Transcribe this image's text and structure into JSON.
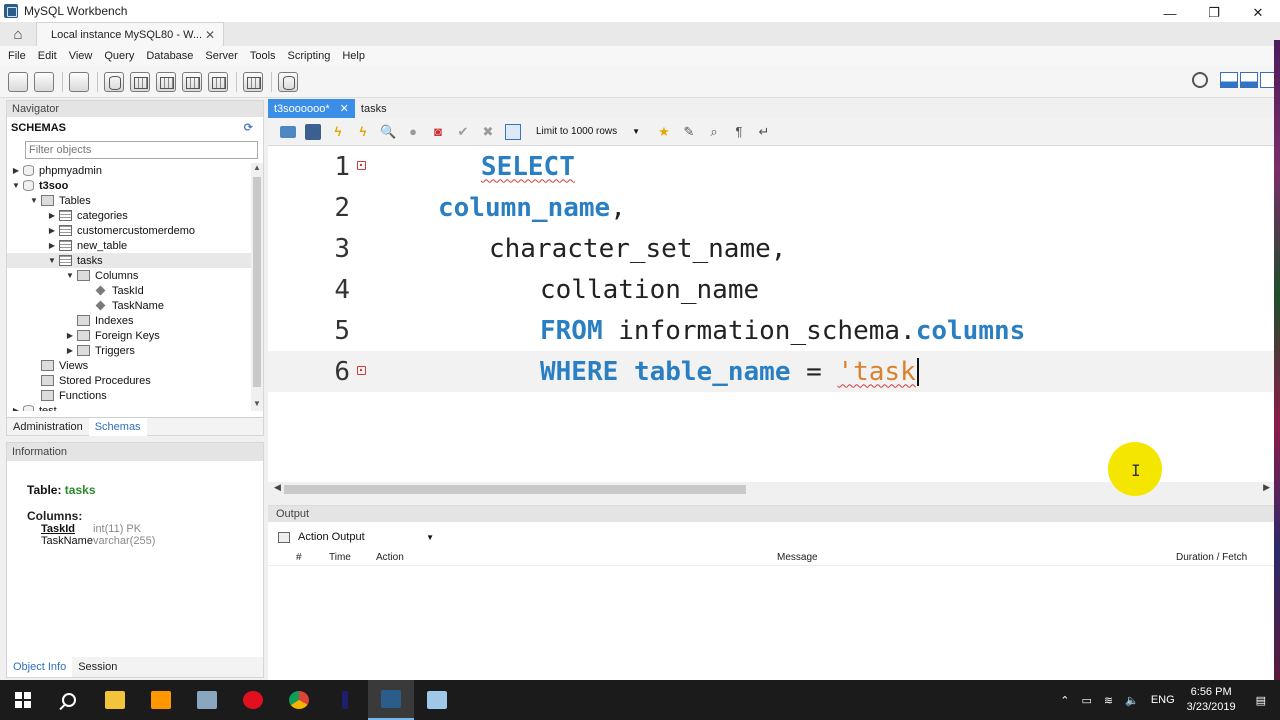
{
  "window": {
    "title": "MySQL Workbench",
    "controls": {
      "minimize": "—",
      "maximize": "❐",
      "close": "✕"
    }
  },
  "connection_tab": {
    "label": "Local instance MySQL80 - W...",
    "close": "✕"
  },
  "menu": [
    "File",
    "Edit",
    "View",
    "Query",
    "Database",
    "Server",
    "Tools",
    "Scripting",
    "Help"
  ],
  "navigator": {
    "header": "Navigator",
    "schemas_label": "SCHEMAS",
    "filter_placeholder": "Filter objects",
    "tree": [
      {
        "label": "phpmyadmin",
        "arrow": "▶",
        "icon": "db",
        "level": 0
      },
      {
        "label": "t3soo",
        "arrow": "▼",
        "icon": "db",
        "level": 0,
        "bold": true
      },
      {
        "label": "Tables",
        "arrow": "▼",
        "icon": "folder",
        "level": 1
      },
      {
        "label": "categories",
        "arrow": "▶",
        "icon": "table",
        "level": 2
      },
      {
        "label": "customercustomerdemo",
        "arrow": "▶",
        "icon": "table",
        "level": 2
      },
      {
        "label": "new_table",
        "arrow": "▶",
        "icon": "table",
        "level": 2
      },
      {
        "label": "tasks",
        "arrow": "▼",
        "icon": "table",
        "level": 2,
        "selected": true
      },
      {
        "label": "Columns",
        "arrow": "▼",
        "icon": "folder",
        "level": 3
      },
      {
        "label": "TaskId",
        "arrow": "",
        "icon": "diamond",
        "level": 4
      },
      {
        "label": "TaskName",
        "arrow": "",
        "icon": "diamond",
        "level": 4
      },
      {
        "label": "Indexes",
        "arrow": "",
        "icon": "folder",
        "level": 3
      },
      {
        "label": "Foreign Keys",
        "arrow": "▶",
        "icon": "folder",
        "level": 3
      },
      {
        "label": "Triggers",
        "arrow": "▶",
        "icon": "folder",
        "level": 3
      },
      {
        "label": "Views",
        "arrow": "",
        "icon": "folder",
        "level": 1
      },
      {
        "label": "Stored Procedures",
        "arrow": "",
        "icon": "folder",
        "level": 1
      },
      {
        "label": "Functions",
        "arrow": "",
        "icon": "folder",
        "level": 1
      },
      {
        "label": "test",
        "arrow": "▶",
        "icon": "db",
        "level": 0
      }
    ],
    "tabs": [
      "Administration",
      "Schemas"
    ],
    "active_tab": "Schemas"
  },
  "information": {
    "header": "Information",
    "table_label": "Table:",
    "table_name": "tasks",
    "columns_label": "Columns:",
    "columns": [
      {
        "name": "TaskId",
        "type": "int(11) PK",
        "pk": true
      },
      {
        "name": "TaskName",
        "type": "varchar(255)",
        "pk": false
      }
    ],
    "tabs": [
      "Object Info",
      "Session"
    ],
    "active_tab": "Object Info"
  },
  "editor_tabs": [
    {
      "label": "t3soooooo*",
      "active": true
    },
    {
      "label": "tasks",
      "active": false
    }
  ],
  "editor_toolbar": {
    "limit_label": "Limit to 1000 rows"
  },
  "code_lines": [
    {
      "n": "1",
      "err": true,
      "parts": [
        {
          "t": "SELECT",
          "c": "kw squiggle"
        }
      ]
    },
    {
      "n": "2",
      "err": false,
      "parts": [
        {
          "t": "column_name",
          "c": "kw"
        },
        {
          "t": ",",
          "c": "id"
        }
      ]
    },
    {
      "n": "3",
      "err": false,
      "parts": [
        {
          "t": "character_set_name,",
          "c": "id"
        }
      ]
    },
    {
      "n": "4",
      "err": false,
      "parts": [
        {
          "t": "collation_name",
          "c": "id"
        }
      ]
    },
    {
      "n": "5",
      "err": false,
      "parts": [
        {
          "t": "FROM",
          "c": "kw"
        },
        {
          "t": " information_schema.",
          "c": "id"
        },
        {
          "t": "columns",
          "c": "kw"
        }
      ]
    },
    {
      "n": "6",
      "err": true,
      "current": true,
      "parts": [
        {
          "t": "WHERE",
          "c": "kw"
        },
        {
          "t": " ",
          "c": "id"
        },
        {
          "t": "table_name",
          "c": "kw"
        },
        {
          "t": " = ",
          "c": "id"
        },
        {
          "t": "'task",
          "c": "str squiggle"
        }
      ]
    }
  ],
  "output": {
    "header": "Output",
    "selector": "Action Output",
    "columns": [
      "#",
      "Time",
      "Action",
      "Message",
      "Duration / Fetch"
    ]
  },
  "taskbar": {
    "lang": "ENG",
    "time": "6:56 PM",
    "date": "3/23/2019"
  }
}
